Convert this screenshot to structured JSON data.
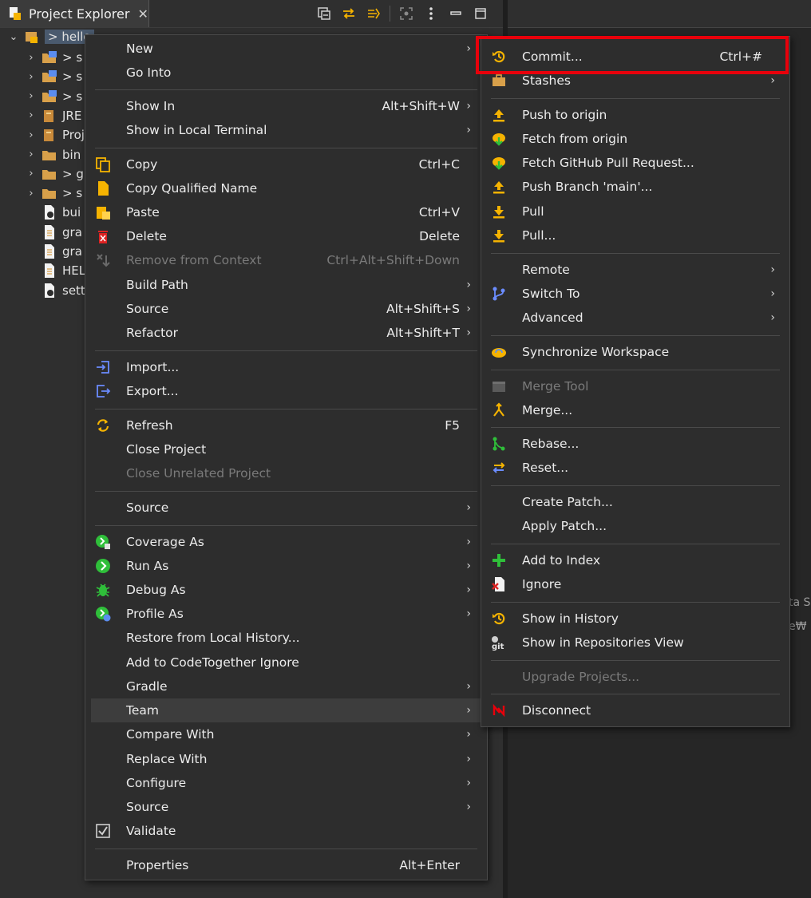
{
  "tab": {
    "title": "Project Explorer",
    "close": "✕"
  },
  "tree": {
    "root_label": "> hello",
    "items": [
      {
        "label": "> s",
        "icon": "source-folder-icon"
      },
      {
        "label": "> s",
        "icon": "source-folder-icon"
      },
      {
        "label": "> s",
        "icon": "source-folder-icon"
      },
      {
        "label": "JRE",
        "icon": "library-icon"
      },
      {
        "label": "Proj",
        "icon": "library-icon"
      },
      {
        "label": "bin",
        "icon": "folder-icon"
      },
      {
        "label": "> g",
        "icon": "folder-icon"
      },
      {
        "label": "> s",
        "icon": "folder-icon"
      },
      {
        "label": "bui",
        "icon": "gradle-file-icon"
      },
      {
        "label": "gra",
        "icon": "file-icon"
      },
      {
        "label": "gra",
        "icon": "file-icon"
      },
      {
        "label": "HEL",
        "icon": "file-icon"
      },
      {
        "label": "sett",
        "icon": "gradle-file-icon"
      }
    ]
  },
  "right_fragment": [
    "ta S",
    "e₩"
  ],
  "context_menu": {
    "new": "New",
    "go_into": "Go Into",
    "show_in": "Show In",
    "show_in_accel": "Alt+Shift+W",
    "show_in_terminal": "Show in Local Terminal",
    "copy": "Copy",
    "copy_accel": "Ctrl+C",
    "copy_qualified": "Copy Qualified Name",
    "paste": "Paste",
    "paste_accel": "Ctrl+V",
    "delete": "Delete",
    "delete_accel": "Delete",
    "remove_context": "Remove from Context",
    "remove_context_accel": "Ctrl+Alt+Shift+Down",
    "build_path": "Build Path",
    "source": "Source",
    "source_accel": "Alt+Shift+S",
    "refactor": "Refactor",
    "refactor_accel": "Alt+Shift+T",
    "import": "Import...",
    "export": "Export...",
    "refresh": "Refresh",
    "refresh_accel": "F5",
    "close_project": "Close Project",
    "close_unrelated": "Close Unrelated Project",
    "source2": "Source",
    "coverage_as": "Coverage As",
    "run_as": "Run As",
    "debug_as": "Debug As",
    "profile_as": "Profile As",
    "restore_history": "Restore from Local History...",
    "codetogether_ignore": "Add to CodeTogether Ignore",
    "gradle": "Gradle",
    "team": "Team",
    "compare_with": "Compare With",
    "replace_with": "Replace With",
    "configure": "Configure",
    "source3": "Source",
    "validate": "Validate",
    "properties": "Properties",
    "properties_accel": "Alt+Enter"
  },
  "team_menu": {
    "commit": "Commit...",
    "commit_accel": "Ctrl+#",
    "stashes": "Stashes",
    "push_origin": "Push to origin",
    "fetch_origin": "Fetch from origin",
    "fetch_pr": "Fetch GitHub Pull Request...",
    "push_branch": "Push Branch 'main'...",
    "pull": "Pull",
    "pull_dialog": "Pull...",
    "remote": "Remote",
    "switch_to": "Switch To",
    "advanced": "Advanced",
    "synchronize": "Synchronize Workspace",
    "merge_tool": "Merge Tool",
    "merge": "Merge...",
    "rebase": "Rebase...",
    "reset": "Reset...",
    "create_patch": "Create Patch...",
    "apply_patch": "Apply Patch...",
    "add_index": "Add to Index",
    "ignore": "Ignore",
    "show_history": "Show in History",
    "show_repos": "Show in Repositories View",
    "upgrade": "Upgrade Projects...",
    "disconnect": "Disconnect"
  },
  "arrow": "›",
  "colors": {
    "highlight_box": "#e8000b",
    "git_orange": "#f5b301",
    "run_green": "#2fbf3a"
  }
}
